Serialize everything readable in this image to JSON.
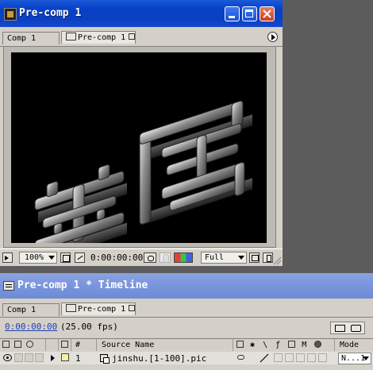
{
  "comp_window": {
    "title": "Pre-comp 1",
    "tabs": [
      {
        "label": "Comp 1"
      },
      {
        "label": "Pre-comp 1"
      }
    ],
    "footer": {
      "zoom": "100%",
      "timecode": "0:00:00:00",
      "resolution": "Full"
    }
  },
  "timeline_window": {
    "title": "Pre-comp 1 * Timeline",
    "tabs": [
      {
        "label": "Comp 1"
      },
      {
        "label": "Pre-comp 1"
      }
    ],
    "current_time": "0:00:00:00",
    "fps": "(25.00 fps)",
    "columns": {
      "number": "#",
      "source_name": "Source Name",
      "mode": "Mode"
    },
    "layers": [
      {
        "index": "1",
        "source_name": "jinshu.[1-100].pic",
        "mode": "N...1"
      }
    ]
  },
  "colors": {
    "title_active": "#0b3fc1",
    "title_inactive": "#7b96dc",
    "timecode_blue": "#1d3fb8",
    "label_yellow": "#f3eea6"
  }
}
